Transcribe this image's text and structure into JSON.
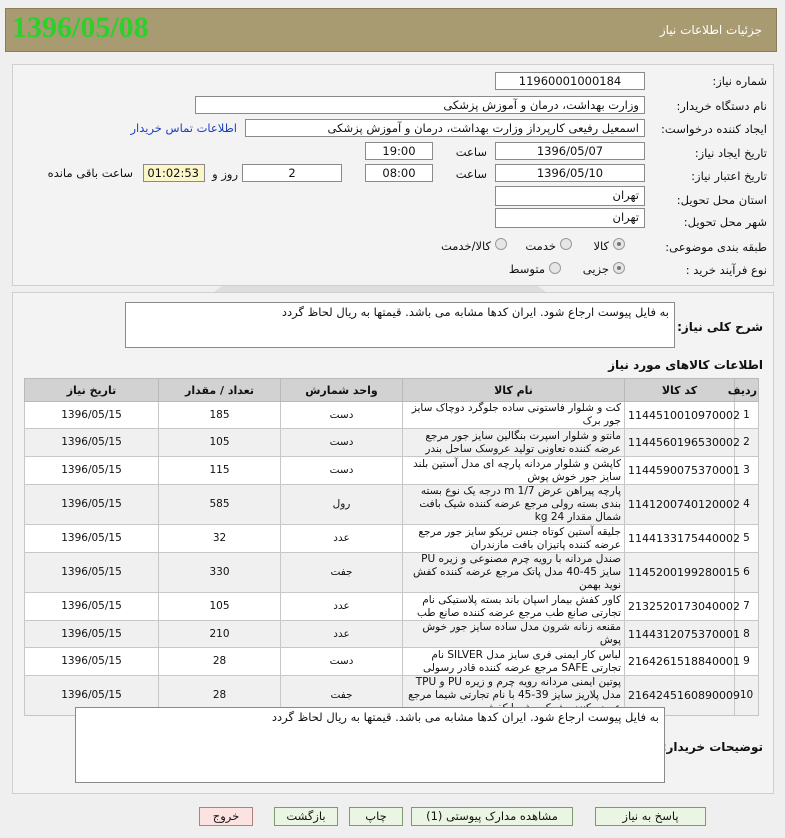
{
  "header": {
    "title": "جزئیات اطلاعات نیاز",
    "date": "1396/05/08"
  },
  "form": {
    "need_number_label": "شماره نیاز:",
    "need_number": "1196000100018‌4",
    "buyer_org_label": "نام دستگاه خریدار:",
    "buyer_org": "وزارت بهداشت، درمان و آموزش پزشکی",
    "requester_label": "ایجاد کننده درخواست:",
    "requester": "اسمعیل رفیعی کارپرداز وزارت بهداشت، درمان و آموزش پزشکی",
    "contact_link": "اطلاعات تماس خریدار",
    "created_label": "تاریخ ایجاد نیاز:",
    "created_date": "1396/05/07",
    "time_label": "ساعت",
    "created_time": "19:00",
    "validity_label": "تاریخ اعتبار نیاز:",
    "validity_date": "1396/05/10",
    "validity_time": "08:00",
    "days": "2",
    "days_label": "روز و",
    "remaining_time": "01:02:53",
    "remaining_label": "ساعت باقی مانده",
    "province_label": "استان محل تحویل:",
    "province": "تهران",
    "city_label": "شهر محل تحویل:",
    "city": "تهران",
    "category_label": "طبقه بندی موضوعی:",
    "category_options": [
      "کالا",
      "خدمت",
      "کالا/خدمت"
    ],
    "category_selected": "کالا",
    "process_label": "نوع فرآیند خرید :",
    "process_options": [
      "جزیی",
      "متوسط"
    ],
    "process_selected": "جزیی"
  },
  "description": {
    "label": "شرح کلی نیاز:",
    "text": "به فایل پیوست ارجاع شود. ایران کدها مشابه می باشد. قیمتها به ریال لحاظ گردد"
  },
  "items_section": {
    "title": "اطلاعات کالاهای مورد نیاز",
    "columns": [
      "ردیف",
      "کد کالا",
      "نام کالا",
      "واحد شمارش",
      "تعداد / مقدار",
      "تاریخ نیاز"
    ],
    "rows": [
      {
        "row": "1",
        "code": "1144510010970002",
        "name": "کت و شلوار فاستونی ساده جلوگرد دوچاک سایز جور برک",
        "unit": "دست",
        "qty": "185",
        "date": "1396/05/15"
      },
      {
        "row": "2",
        "code": "1144560196530002",
        "name": "مانتو و شلوار اسپرت بنگالین سایز جور مرجع عرضه کننده تعاونی تولید عروسک ساحل بندر",
        "unit": "دست",
        "qty": "105",
        "date": "1396/05/15"
      },
      {
        "row": "3",
        "code": "1144590075370001",
        "name": "کاپشن و شلوار مردانه پارچه ای مدل آستین بلند سایز جور خوش پوش",
        "unit": "دست",
        "qty": "115",
        "date": "1396/05/15"
      },
      {
        "row": "4",
        "code": "1141200740120002",
        "name": "پارچه پیراهن عرض m 1/7 درجه یک نوع بسته بندی بسته رولی مرجع عرضه کننده شیک بافت شمال مقدار kg 24",
        "unit": "رول",
        "qty": "585",
        "date": "1396/05/15"
      },
      {
        "row": "5",
        "code": "1144133175440002",
        "name": "جلیقه آستین کوتاه جنس تریکو سایز جور مرجع عرضه کننده پاتیزان بافت مازندران",
        "unit": "عدد",
        "qty": "32",
        "date": "1396/05/15"
      },
      {
        "row": "6",
        "code": "1145200199280015",
        "name": "صندل مردانه با رویه چرم مصنوعی و زیره PU سایز 45-40 مدل پاتک مرجع عرضه کننده کفش نوید بهمن",
        "unit": "جفت",
        "qty": "330",
        "date": "1396/05/15"
      },
      {
        "row": "7",
        "code": "2132520173040002",
        "name": "کاور کفش بیمار اسپان باند بسته پلاستیکی نام تجارتی صانع طب مرجع عرضه کننده صانع طب",
        "unit": "عدد",
        "qty": "105",
        "date": "1396/05/15"
      },
      {
        "row": "8",
        "code": "1144312075370001",
        "name": "مقنعه زنانه شرون مدل ساده سایز جور خوش پوش",
        "unit": "عدد",
        "qty": "210",
        "date": "1396/05/15"
      },
      {
        "row": "9",
        "code": "2164261518840001",
        "name": "لباس کار ایمنی فری سایز مدل SILVER نام تجارتی SAFE مرجع عرضه کننده قادر رسولی",
        "unit": "دست",
        "qty": "28",
        "date": "1396/05/15"
      },
      {
        "row": "10",
        "code": "2164245160890009",
        "name": "پوتین ایمنی مردانه رویه چرم و زیره PU و TPU مدل پلاریز سایز 39-45 با نام تجارتی شیما مرجع عرضه کننده شرکت شیما کفش",
        "unit": "جفت",
        "qty": "28",
        "date": "1396/05/15"
      }
    ]
  },
  "buyer_notes": {
    "label": "توضیحات خریدار:",
    "text": "به فایل پیوست ارجاع شود. ایران کدها مشابه می باشد. قیمتها به ریال لحاظ گردد"
  },
  "buttons": {
    "respond": "پاسخ به نیاز",
    "attachments": "مشاهده مدارک پیوستی (1)",
    "print": "چاپ",
    "back": "بازگشت",
    "exit": "خروج"
  }
}
